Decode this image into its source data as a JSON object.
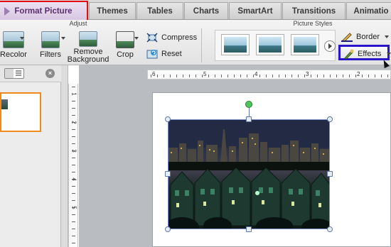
{
  "tabs": [
    {
      "label": "Format Picture",
      "active": true
    },
    {
      "label": "Themes"
    },
    {
      "label": "Tables"
    },
    {
      "label": "Charts"
    },
    {
      "label": "SmartArt"
    },
    {
      "label": "Transitions"
    },
    {
      "label": "Animatio"
    }
  ],
  "ribbon": {
    "groups": {
      "adjust": "Adjust",
      "picture_styles": "Picture Styles"
    },
    "buttons": {
      "recolor": "Recolor",
      "filters": "Filters",
      "remove_background": "Remove\nBackground",
      "crop": "Crop",
      "compress": "Compress",
      "reset": "Reset",
      "border": "Border",
      "effects": "Effects"
    }
  },
  "highlight_colors": {
    "format_picture_tab": "#e01010",
    "effects_button": "#2a16c8"
  },
  "rulers": {
    "horizontal_labels": [
      "6",
      "5",
      "4",
      "3",
      "2"
    ],
    "vertical_labels": [
      "1",
      "2",
      "3",
      "4",
      "5"
    ]
  },
  "picture": {
    "icon": "city-houses-night-photo"
  }
}
